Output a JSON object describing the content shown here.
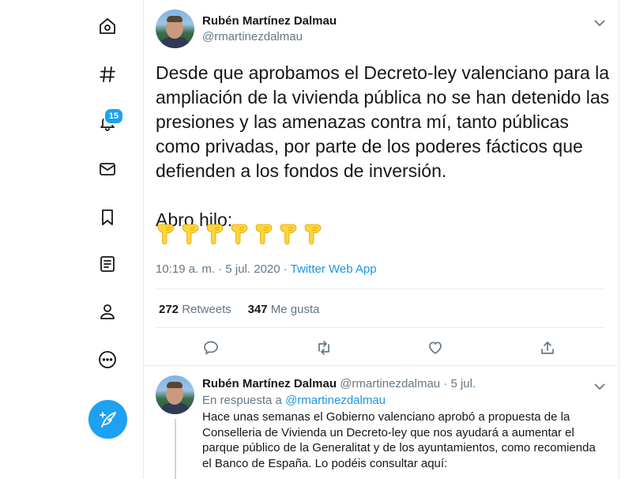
{
  "sidebar": {
    "notifications_count": "15",
    "items": [
      {
        "name": "home",
        "icon": "home-icon"
      },
      {
        "name": "explore",
        "icon": "hashtag-icon"
      },
      {
        "name": "notifications",
        "icon": "bell-icon"
      },
      {
        "name": "messages",
        "icon": "envelope-icon"
      },
      {
        "name": "bookmarks",
        "icon": "bookmark-icon"
      },
      {
        "name": "lists",
        "icon": "list-icon"
      },
      {
        "name": "profile",
        "icon": "user-icon"
      },
      {
        "name": "more",
        "icon": "more-icon"
      }
    ],
    "compose_icon": "compose-tweet-icon"
  },
  "tweet": {
    "author_name": "Rubén Martínez Dalmau",
    "author_handle": "@rmartinezdalmau",
    "text": "Desde que aprobamos el Decreto-ley valenciano para la ampliación de la vivienda pública no se han detenido las presiones y las amenazas contra mí, tanto públicas como privadas, por parte de los poderes fácticos que defienden a los fondos de inversión.\n\nAbro hilo:",
    "emoji_count": 7,
    "emoji_icon": "pointing-down-hand-emoji",
    "time": "10:19 a. m. · 5 jul. 2020 · ",
    "source": "Twitter Web App",
    "retweets_count": "272",
    "retweets_label": "Retweets",
    "likes_count": "347",
    "likes_label": "Me gusta"
  },
  "reply": {
    "author_name": "Rubén Martínez Dalmau",
    "author_handle": "@rmartinezdalmau · 5 jul.",
    "in_reply_prefix": "En respuesta a ",
    "in_reply_mention": "@rmartinezdalmau",
    "text": "Hace unas semanas el Gobierno valenciano aprobó a propuesta de la Conselleria de Vivienda un Decreto-ley que nos ayudará a aumentar el parque público de la Generalitat y de los ayuntamientos, como recomienda el Banco de España. Lo podéis consultar aquí:"
  },
  "colors": {
    "accent": "#1da1f2",
    "link": "#1b95e0",
    "muted": "#657786",
    "text": "#14171a",
    "emoji": "#ffd43b"
  }
}
